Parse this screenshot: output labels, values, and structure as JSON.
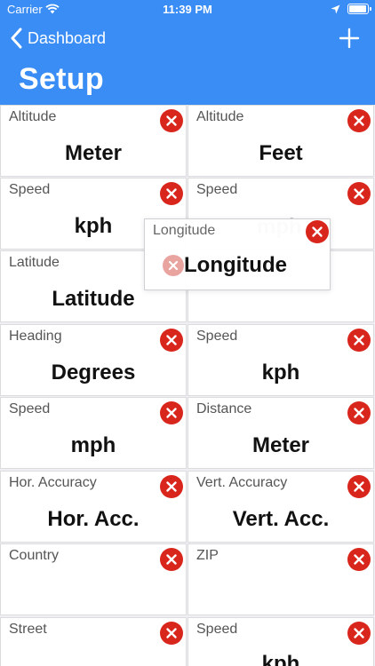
{
  "status_bar": {
    "carrier": "Carrier",
    "time": "11:39 PM"
  },
  "nav": {
    "back_label": "Dashboard",
    "title": "Setup"
  },
  "tiles": [
    {
      "label": "Altitude",
      "value": "Meter"
    },
    {
      "label": "Altitude",
      "value": "Feet"
    },
    {
      "label": "Speed",
      "value": "kph"
    },
    {
      "label": "Speed",
      "value": ""
    },
    {
      "label": "Latitude",
      "value": "Latitude"
    },
    {
      "label": "",
      "value": ""
    },
    {
      "label": "Heading",
      "value": "Degrees"
    },
    {
      "label": "Speed",
      "value": "kph"
    },
    {
      "label": "Speed",
      "value": "mph"
    },
    {
      "label": "Distance",
      "value": "Meter"
    },
    {
      "label": "Hor. Accuracy",
      "value": "Hor. Acc."
    },
    {
      "label": "Vert. Accuracy",
      "value": "Vert. Acc."
    },
    {
      "label": "Country",
      "value": ""
    },
    {
      "label": "ZIP",
      "value": ""
    },
    {
      "label": "Street",
      "value": ""
    },
    {
      "label": "Speed",
      "value": "kph"
    }
  ],
  "dragging_tile": {
    "label": "Longitude",
    "value": "Longitude"
  },
  "ghost_value": "mph",
  "colors": {
    "nav_blue": "#3a8df5",
    "delete_red": "#d9261c"
  }
}
